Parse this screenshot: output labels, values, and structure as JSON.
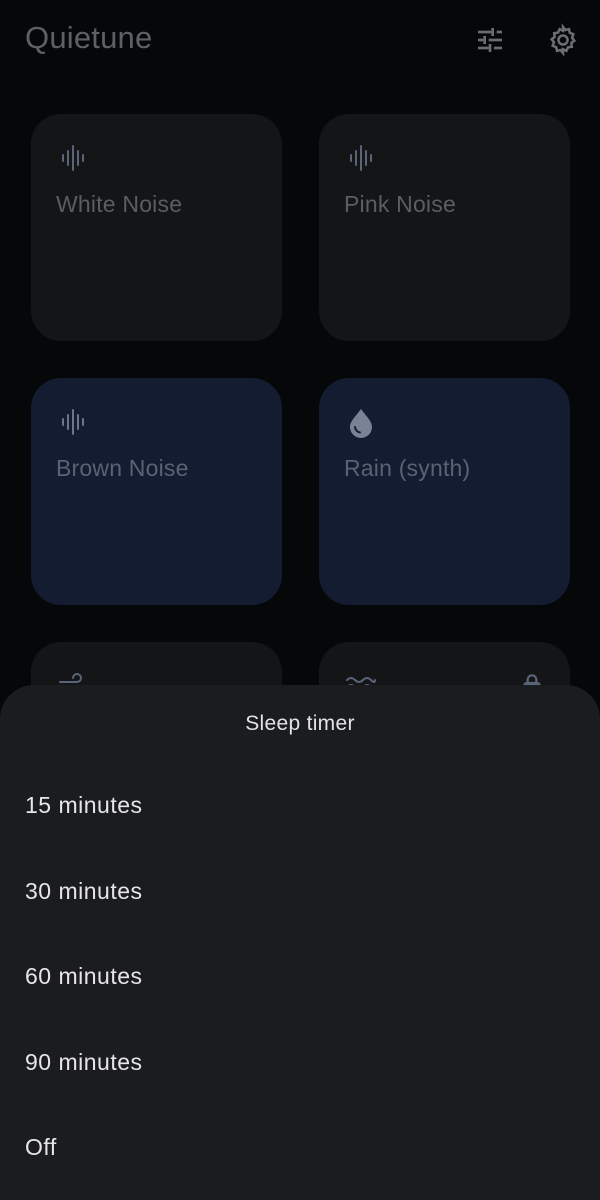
{
  "app_bar": {
    "title": "Quietune",
    "tune_icon": "tune-sliders-icon",
    "settings_icon": "gear-icon"
  },
  "sounds": [
    {
      "label": "White Noise",
      "icon": "waveform-icon",
      "active": false
    },
    {
      "label": "Pink Noise",
      "icon": "waveform-icon",
      "active": false
    },
    {
      "label": "Brown Noise",
      "icon": "waveform-icon",
      "active": true
    },
    {
      "label": "Rain (synth)",
      "icon": "water-drop-icon",
      "active": true
    },
    {
      "label": "",
      "icon": "wind-icon",
      "active": false
    },
    {
      "label": "",
      "icon": "waves-icon",
      "active": false,
      "locked": true
    }
  ],
  "sleep_timer": {
    "title": "Sleep timer",
    "options": [
      "15 minutes",
      "30 minutes",
      "60 minutes",
      "90 minutes",
      "Off"
    ]
  },
  "colors": {
    "background": "#060708",
    "tile": "#141517",
    "tile_active": "#131c31",
    "sheet": "#1b1c20",
    "icon_muted": "#5a6478",
    "icon_active": "#7a8396"
  }
}
